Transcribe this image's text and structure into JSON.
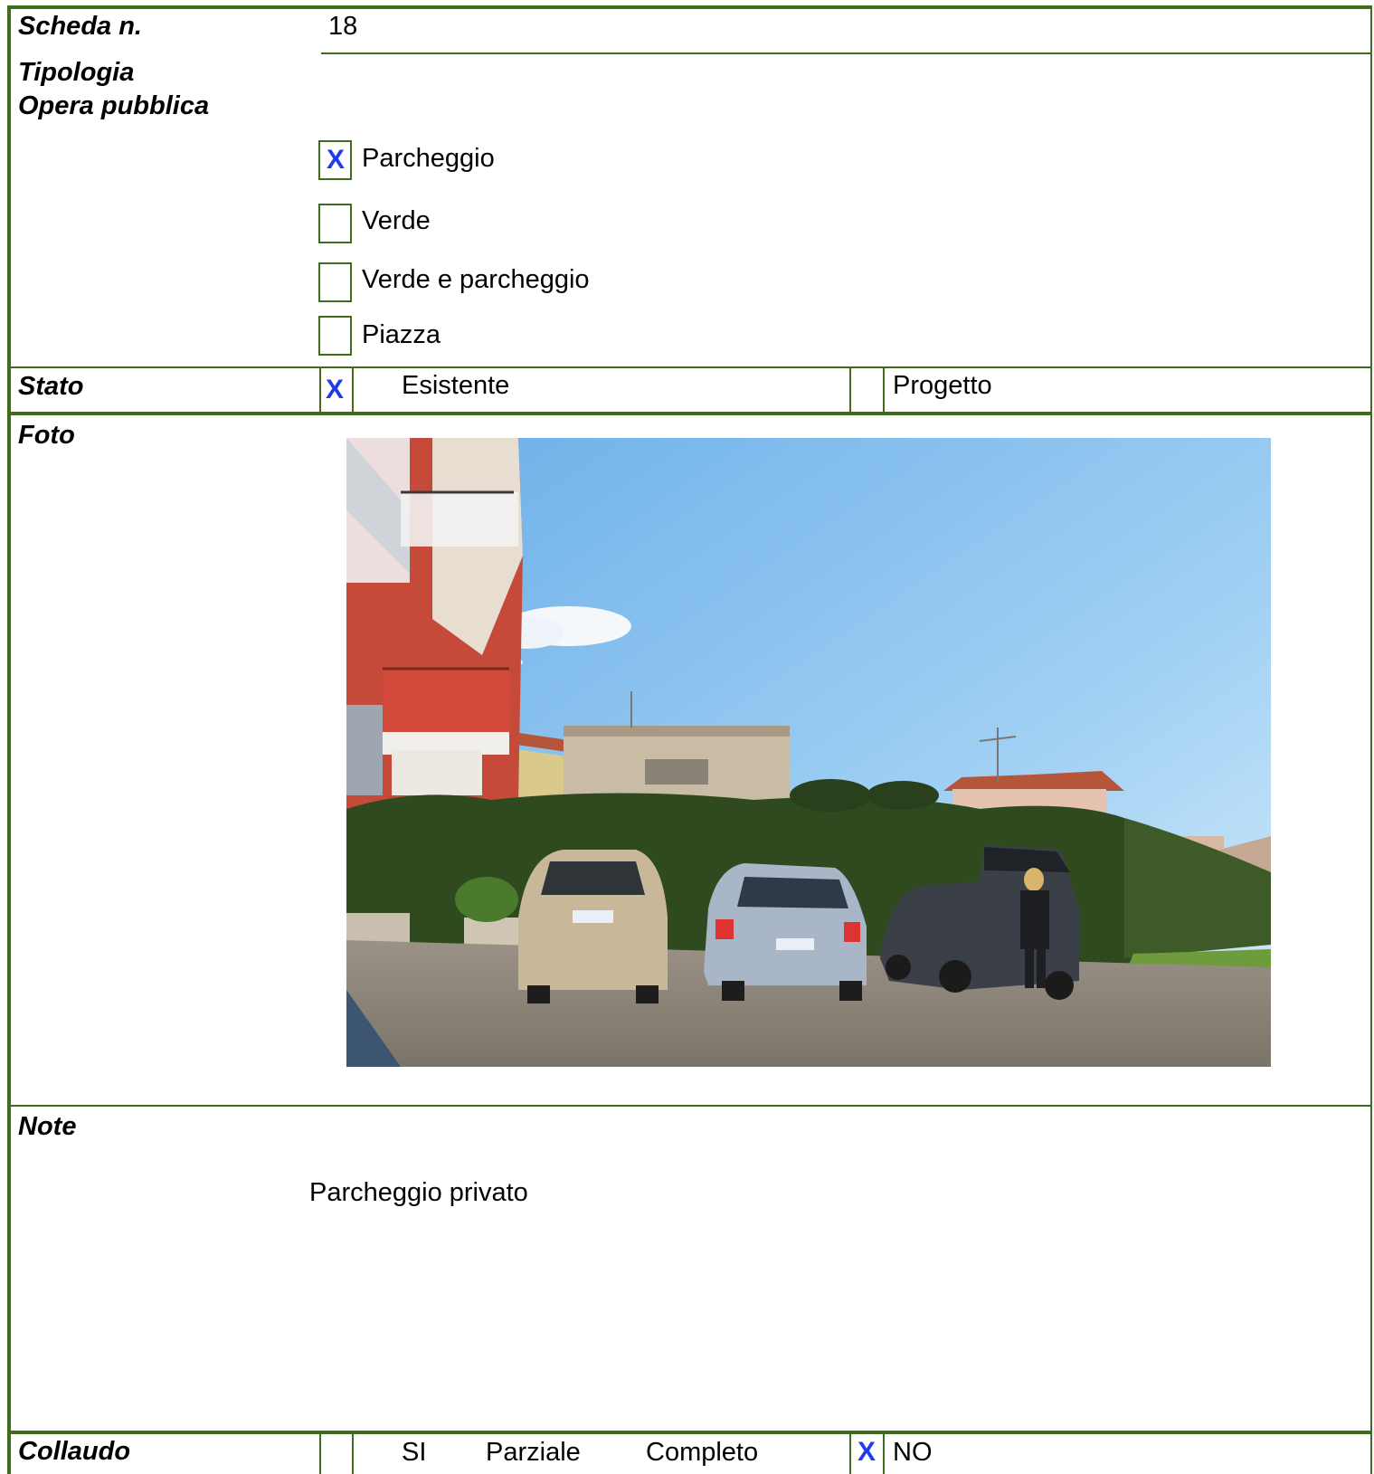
{
  "scheda": {
    "label": "Scheda n.",
    "value": "18"
  },
  "tipologia": {
    "label_line1": "Tipologia",
    "label_line2": "Opera pubblica",
    "options": [
      {
        "label": "Parcheggio",
        "checked": true,
        "mark": "X"
      },
      {
        "label": "Verde",
        "checked": false,
        "mark": ""
      },
      {
        "label": "Verde e parcheggio",
        "checked": false,
        "mark": ""
      },
      {
        "label": "Piazza",
        "checked": false,
        "mark": ""
      }
    ]
  },
  "stato": {
    "label": "Stato",
    "esistente": {
      "label": "Esistente",
      "mark": "X"
    },
    "progetto": {
      "label": "Progetto",
      "mark": ""
    }
  },
  "foto": {
    "label": "Foto"
  },
  "note": {
    "label": "Note",
    "text": "Parcheggio privato"
  },
  "collaudo": {
    "label": "Collaudo",
    "si": "SI",
    "parziale": "Parziale",
    "completo": "Completo",
    "no": "NO",
    "no_mark": "X"
  },
  "colors": {
    "border": "#3f6d1c",
    "mark": "#1f3bf0"
  }
}
